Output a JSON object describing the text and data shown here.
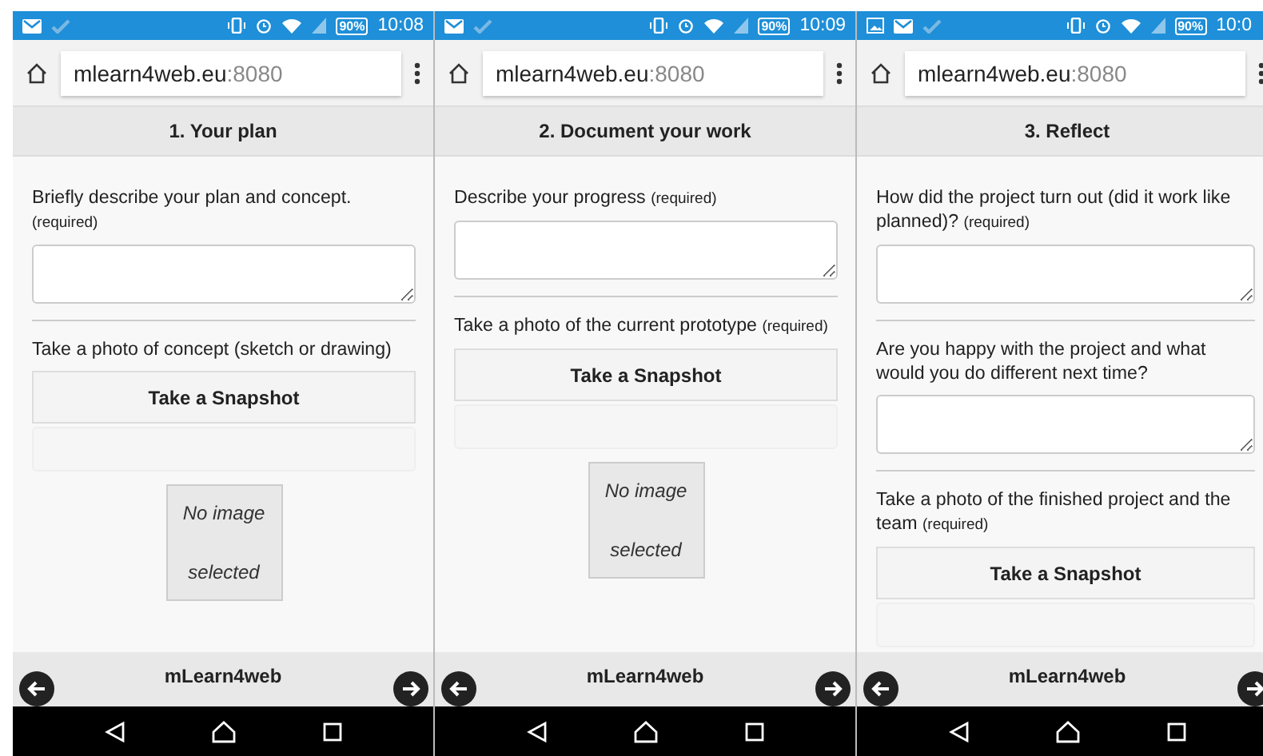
{
  "screens": [
    {
      "status": {
        "notifications": [
          {
            "kind": "mail"
          },
          {
            "kind": "check"
          }
        ],
        "battery": "90%",
        "time": "10:08"
      },
      "address": {
        "host": "mlearn4web.eu",
        "port": ":8080"
      },
      "title": "1. Your plan",
      "fields": [
        {
          "kind": "text",
          "label": "Briefly describe your plan and concept.",
          "note": "(required)"
        },
        {
          "kind": "photo",
          "label": "Take a photo of concept (sketch or drawing)",
          "button": "Take a Snapshot",
          "preview": "No image selected"
        }
      ],
      "footer": "mLearn4web"
    },
    {
      "status": {
        "notifications": [
          {
            "kind": "mail"
          },
          {
            "kind": "check"
          }
        ],
        "battery": "90%",
        "time": "10:09"
      },
      "address": {
        "host": "mlearn4web.eu",
        "port": ":8080"
      },
      "title": "2. Document your work",
      "fields": [
        {
          "kind": "text",
          "label": "Describe your progress",
          "note": "(required)"
        },
        {
          "kind": "photo",
          "label": "Take a photo of the current prototype",
          "note": "(required)",
          "button": "Take a Snapshot",
          "preview": "No image selected"
        }
      ],
      "footer": "mLearn4web"
    },
    {
      "status": {
        "notifications": [
          {
            "kind": "image"
          },
          {
            "kind": "mail"
          },
          {
            "kind": "check"
          }
        ],
        "battery": "90%",
        "time": "10:0"
      },
      "address": {
        "host": "mlearn4web.eu",
        "port": ":8080"
      },
      "title": "3. Reflect",
      "fields": [
        {
          "kind": "text",
          "label": "How did the project turn out (did it work like planned)?",
          "note": "(required)"
        },
        {
          "kind": "text",
          "label": "Are you happy with the project and what would you do different next time?"
        },
        {
          "kind": "photo",
          "label": "Take a photo of the finished project and the team",
          "note": "(required)",
          "button": "Take a Snapshot"
        }
      ],
      "footer": "mLearn4web"
    }
  ]
}
